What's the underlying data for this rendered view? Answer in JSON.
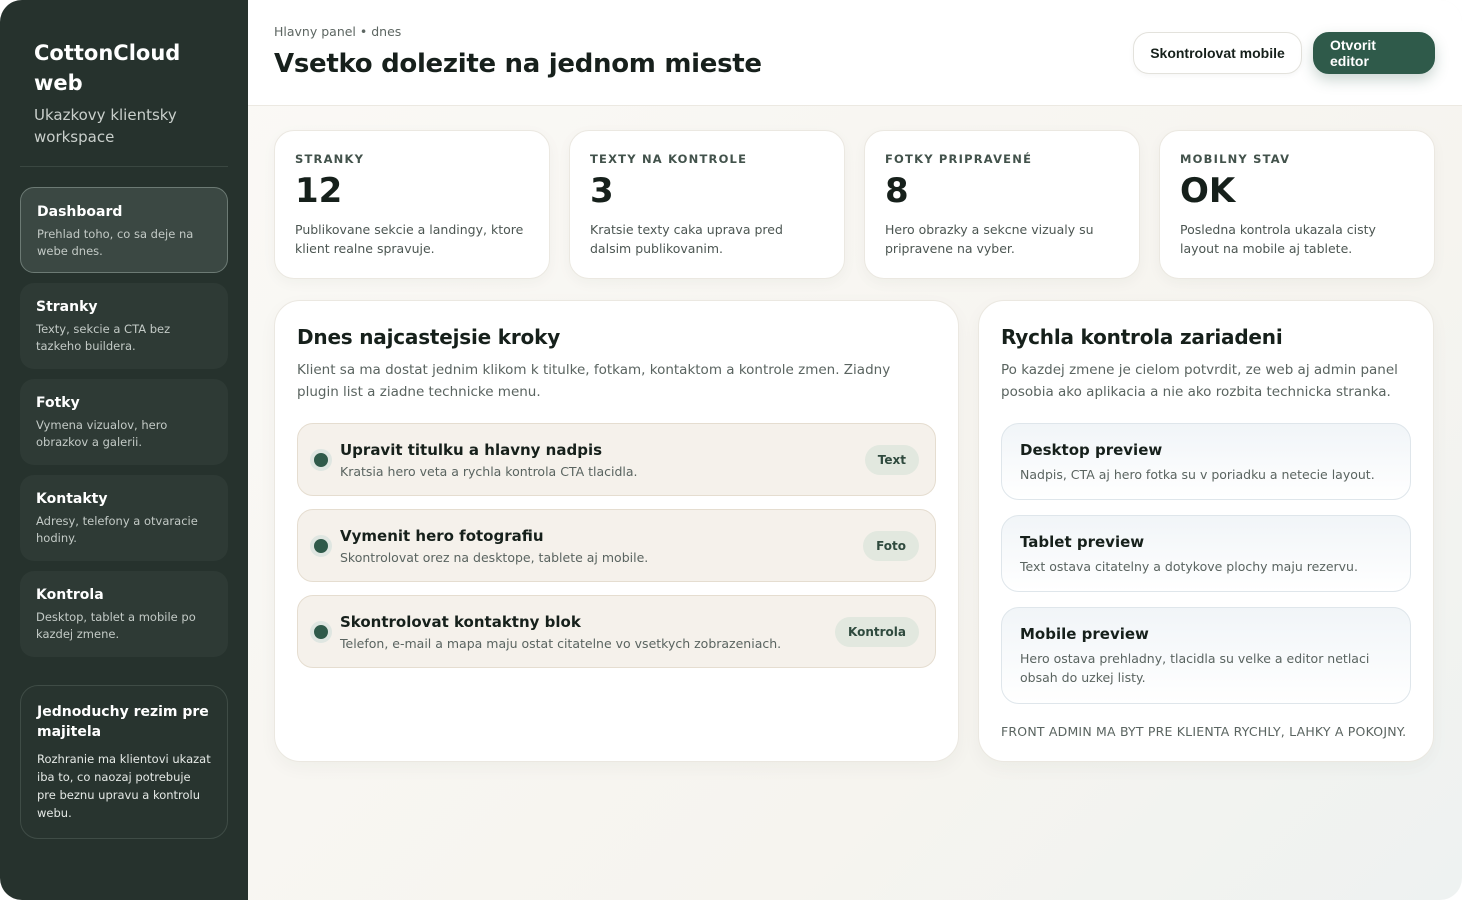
{
  "sidebar": {
    "brand_title": "CottonCloud web",
    "brand_subtitle": "Ukazkovy klientsky workspace",
    "items": [
      {
        "label": "Dashboard",
        "desc": "Prehlad toho, co sa deje na webe dnes."
      },
      {
        "label": "Stranky",
        "desc": "Texty, sekcie a CTA bez tazkeho buildera."
      },
      {
        "label": "Fotky",
        "desc": "Vymena vizualov, hero obrazkov a galerii."
      },
      {
        "label": "Kontakty",
        "desc": "Adresy, telefony a otvaracie hodiny."
      },
      {
        "label": "Kontrola",
        "desc": "Desktop, tablet a mobile po kazdej zmene."
      }
    ],
    "active_item": "Dashboard",
    "info_card": {
      "title": "Jednoduchy rezim pre majitela",
      "text": "Rozhranie ma klientovi ukazat iba to, co naozaj potrebuje pre beznu upravu a kontrolu webu."
    }
  },
  "header": {
    "breadcrumb": "Hlavny panel • dnes",
    "title": "Vsetko dolezite na jednom mieste",
    "buttons": {
      "check_mobile": "Skontrolovat mobile",
      "open_editor": "Otvorit editor"
    }
  },
  "stats": [
    {
      "label": "STRANKY",
      "value": "12",
      "desc": "Publikovane sekcie a landingy, ktore klient realne spravuje."
    },
    {
      "label": "TEXTY NA KONTROLE",
      "value": "3",
      "desc": "Kratsie texty caka uprava pred dalsim publikovanim."
    },
    {
      "label": "FOTKY PRIPRAVENÉ",
      "value": "8",
      "desc": "Hero obrazky a sekcne vizualy su pripravene na vyber."
    },
    {
      "label": "MOBILNY STAV",
      "value": "OK",
      "desc": "Posledna kontrola ukazala cisty layout na mobile aj tablete."
    }
  ],
  "steps_panel": {
    "title": "Dnes najcastejsie kroky",
    "desc": "Klient sa ma dostat jednim klikom k titulke, fotkam, kontaktom a kontrole zmen. Ziadny plugin list a ziadne technicke menu.",
    "steps": [
      {
        "title": "Upravit titulku a hlavny nadpis",
        "desc": "Kratsia hero veta a rychla kontrola CTA tlacidla.",
        "tag": "Text"
      },
      {
        "title": "Vymenit hero fotografiu",
        "desc": "Skontrolovat orez na desktope, tablete aj mobile.",
        "tag": "Foto"
      },
      {
        "title": "Skontrolovat kontaktny blok",
        "desc": "Telefon, e-mail a mapa maju ostat citatelne vo vsetkych zobrazeniach.",
        "tag": "Kontrola"
      }
    ]
  },
  "devices_panel": {
    "title": "Rychla kontrola zariadeni",
    "desc": "Po kazdej zmene je cielom potvrdit, ze web aj admin panel posobia ako aplikacia a nie ako rozbita technicka stranka.",
    "previews": [
      {
        "title": "Desktop preview",
        "desc": "Nadpis, CTA aj hero fotka su v poriadku a netecie layout."
      },
      {
        "title": "Tablet preview",
        "desc": "Text ostava citatelny a dotykove plochy maju rezervu."
      },
      {
        "title": "Mobile preview",
        "desc": "Hero ostava prehladny, tlacidla su velke a editor netlaci obsah do uzkej listy."
      }
    ],
    "footer_note": "FRONT ADMIN MA BYT PRE KLIENTA RYCHLY, LAHKY A POKOJNY."
  },
  "colors": {
    "sidebar_bg": "#26322d",
    "accent": "#2f5a4a",
    "tag_bg": "#e2e8df",
    "step_bg": "#f5f1eb"
  }
}
